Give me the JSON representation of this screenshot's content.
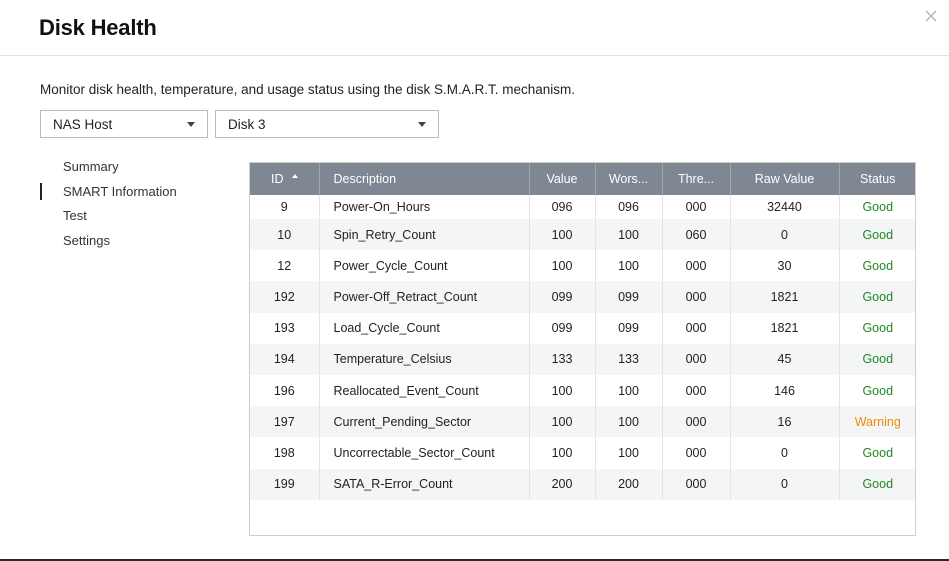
{
  "dialog": {
    "title": "Disk Health",
    "description": "Monitor disk health, temperature, and usage status using the disk S.M.A.R.T. mechanism.",
    "close_icon": "close-icon"
  },
  "selectors": {
    "host": "NAS Host",
    "disk": "Disk 3"
  },
  "nav": {
    "items": [
      {
        "label": "Summary",
        "active": false
      },
      {
        "label": "SMART Information",
        "active": true
      },
      {
        "label": "Test",
        "active": false
      },
      {
        "label": "Settings",
        "active": false
      }
    ]
  },
  "table": {
    "columns": [
      "ID",
      "Description",
      "Value",
      "Wors...",
      "Thre...",
      "Raw Value",
      "Status"
    ],
    "sort_column": "ID",
    "sort_direction": "ascending",
    "rows": [
      {
        "id": "9",
        "description": "Power-On_Hours",
        "value": "096",
        "worst": "096",
        "threshold": "000",
        "raw": "32440",
        "status": "Good"
      },
      {
        "id": "10",
        "description": "Spin_Retry_Count",
        "value": "100",
        "worst": "100",
        "threshold": "060",
        "raw": "0",
        "status": "Good"
      },
      {
        "id": "12",
        "description": "Power_Cycle_Count",
        "value": "100",
        "worst": "100",
        "threshold": "000",
        "raw": "30",
        "status": "Good"
      },
      {
        "id": "192",
        "description": "Power-Off_Retract_Count",
        "value": "099",
        "worst": "099",
        "threshold": "000",
        "raw": "1821",
        "status": "Good"
      },
      {
        "id": "193",
        "description": "Load_Cycle_Count",
        "value": "099",
        "worst": "099",
        "threshold": "000",
        "raw": "1821",
        "status": "Good"
      },
      {
        "id": "194",
        "description": "Temperature_Celsius",
        "value": "133",
        "worst": "133",
        "threshold": "000",
        "raw": "45",
        "status": "Good"
      },
      {
        "id": "196",
        "description": "Reallocated_Event_Count",
        "value": "100",
        "worst": "100",
        "threshold": "000",
        "raw": "146",
        "status": "Good"
      },
      {
        "id": "197",
        "description": "Current_Pending_Sector",
        "value": "100",
        "worst": "100",
        "threshold": "000",
        "raw": "16",
        "status": "Warning"
      },
      {
        "id": "198",
        "description": "Uncorrectable_Sector_Count",
        "value": "100",
        "worst": "100",
        "threshold": "000",
        "raw": "0",
        "status": "Good"
      },
      {
        "id": "199",
        "description": "SATA_R-Error_Count",
        "value": "200",
        "worst": "200",
        "threshold": "000",
        "raw": "0",
        "status": "Good"
      }
    ]
  },
  "colors": {
    "header_bg": "#7f8793",
    "good": "#208a20",
    "warning": "#f08c00"
  }
}
